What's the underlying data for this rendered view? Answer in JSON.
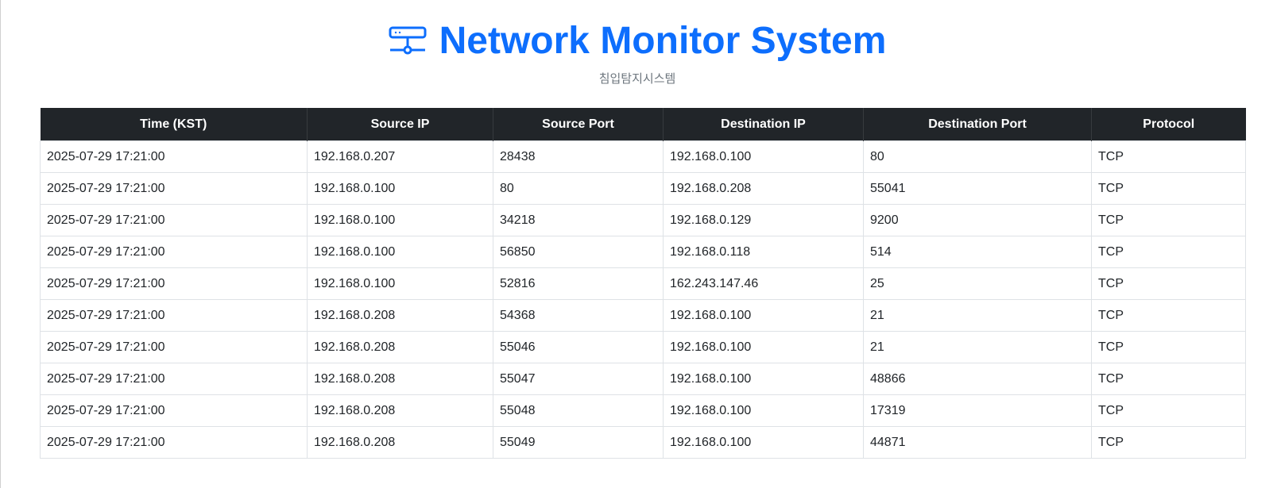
{
  "header": {
    "icon": "server-network-icon",
    "title": "Network Monitor System",
    "subtitle": "침입탐지시스템",
    "accent_color": "#0d6efd"
  },
  "table": {
    "columns": [
      "Time (KST)",
      "Source IP",
      "Source Port",
      "Destination IP",
      "Destination Port",
      "Protocol"
    ],
    "rows": [
      [
        "2025-07-29 17:21:00",
        "192.168.0.207",
        "28438",
        "192.168.0.100",
        "80",
        "TCP"
      ],
      [
        "2025-07-29 17:21:00",
        "192.168.0.100",
        "80",
        "192.168.0.208",
        "55041",
        "TCP"
      ],
      [
        "2025-07-29 17:21:00",
        "192.168.0.100",
        "34218",
        "192.168.0.129",
        "9200",
        "TCP"
      ],
      [
        "2025-07-29 17:21:00",
        "192.168.0.100",
        "56850",
        "192.168.0.118",
        "514",
        "TCP"
      ],
      [
        "2025-07-29 17:21:00",
        "192.168.0.100",
        "52816",
        "162.243.147.46",
        "25",
        "TCP"
      ],
      [
        "2025-07-29 17:21:00",
        "192.168.0.208",
        "54368",
        "192.168.0.100",
        "21",
        "TCP"
      ],
      [
        "2025-07-29 17:21:00",
        "192.168.0.208",
        "55046",
        "192.168.0.100",
        "21",
        "TCP"
      ],
      [
        "2025-07-29 17:21:00",
        "192.168.0.208",
        "55047",
        "192.168.0.100",
        "48866",
        "TCP"
      ],
      [
        "2025-07-29 17:21:00",
        "192.168.0.208",
        "55048",
        "192.168.0.100",
        "17319",
        "TCP"
      ],
      [
        "2025-07-29 17:21:00",
        "192.168.0.208",
        "55049",
        "192.168.0.100",
        "44871",
        "TCP"
      ]
    ]
  }
}
